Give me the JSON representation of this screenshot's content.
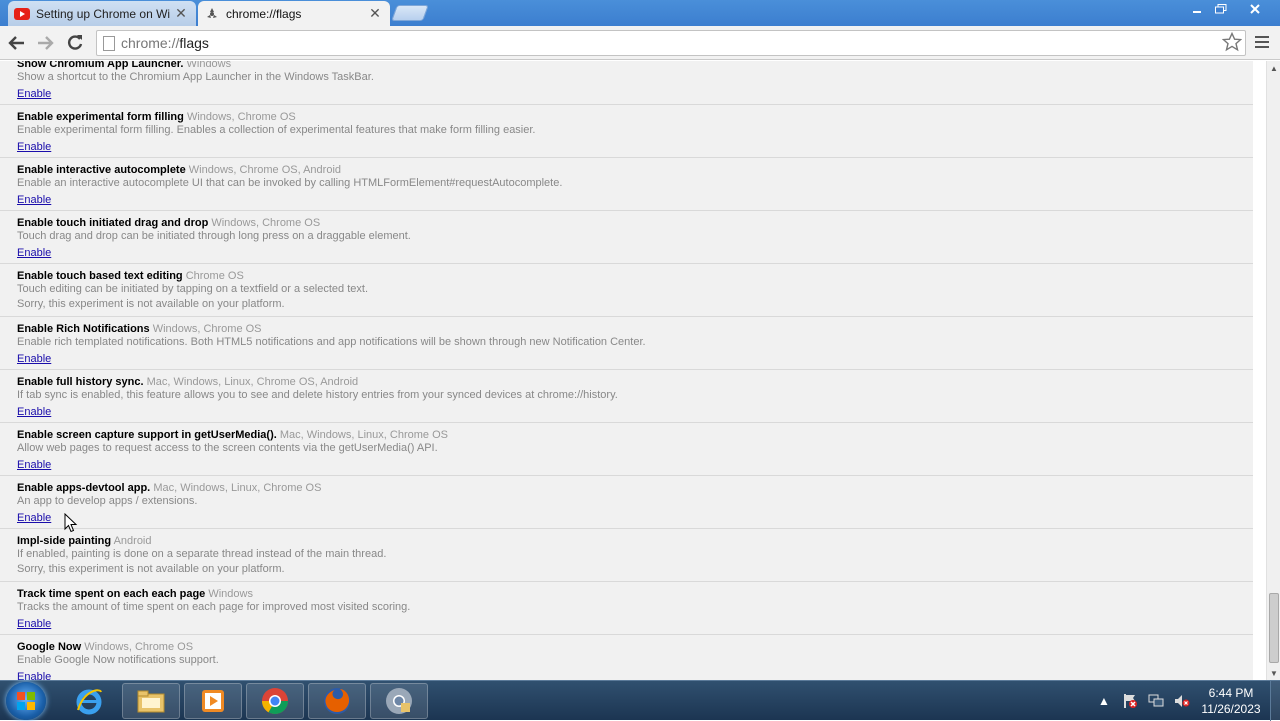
{
  "tabs": [
    {
      "title": "Setting up Chrome on Wi",
      "icon": "youtube-icon",
      "active": false
    },
    {
      "title": "chrome://flags",
      "icon": "flask-icon",
      "active": true
    }
  ],
  "toolbar": {
    "url_scheme": "chrome://",
    "url_host": "flags"
  },
  "experiments_cropped": {
    "name": "Show Chromium App Launcher.",
    "platforms": "Windows",
    "desc": "Show a shortcut to the Chromium App Launcher in the Windows TaskBar.",
    "link": "Enable"
  },
  "experiments": [
    {
      "name": "Enable experimental form filling",
      "platforms": "Windows, Chrome OS",
      "desc": "Enable experimental form filling. Enables a collection of experimental features that make form filling easier.",
      "link": "Enable"
    },
    {
      "name": "Enable interactive autocomplete",
      "platforms": "Windows, Chrome OS, Android",
      "desc": "Enable an interactive autocomplete UI that can be invoked by calling HTMLFormElement#requestAutocomplete.",
      "link": "Enable"
    },
    {
      "name": "Enable touch initiated drag and drop",
      "platforms": "Windows, Chrome OS",
      "desc": "Touch drag and drop can be initiated through long press on a draggable element.",
      "link": "Enable"
    },
    {
      "name": "Enable touch based text editing",
      "platforms": "Chrome OS",
      "desc": "Touch editing can be initiated by tapping on a textfield or a selected text.",
      "unavailable": "Sorry, this experiment is not available on your platform."
    },
    {
      "name": "Enable Rich Notifications",
      "platforms": "Windows, Chrome OS",
      "desc": "Enable rich templated notifications. Both HTML5 notifications and app notifications will be shown through new Notification Center.",
      "link": "Enable"
    },
    {
      "name": "Enable full history sync.",
      "platforms": "Mac, Windows, Linux, Chrome OS, Android",
      "desc": "If tab sync is enabled, this feature allows you to see and delete history entries from your synced devices at chrome://history.",
      "link": "Enable"
    },
    {
      "name": "Enable screen capture support in getUserMedia().",
      "platforms": "Mac, Windows, Linux, Chrome OS",
      "desc": "Allow web pages to request access to the screen contents via the getUserMedia() API.",
      "link": "Enable"
    },
    {
      "name": "Enable apps-devtool app.",
      "platforms": "Mac, Windows, Linux, Chrome OS",
      "desc": "An app to develop apps / extensions.",
      "link": "Enable"
    },
    {
      "name": "Impl-side painting",
      "platforms": "Android",
      "desc": "If enabled, painting is done on a separate thread instead of the main thread.",
      "unavailable": "Sorry, this experiment is not available on your platform."
    },
    {
      "name": "Track time spent on each each page",
      "platforms": "Windows",
      "desc": "Tracks the amount of time spent on each page for improved most visited scoring.",
      "link": "Enable"
    },
    {
      "name": "Google Now",
      "platforms": "Windows, Chrome OS",
      "desc": "Enable Google Now notifications support.",
      "link": "Enable"
    }
  ],
  "taskbar": {
    "items": [
      "internet-explorer-icon",
      "file-explorer-icon",
      "media-player-icon",
      "chrome-icon",
      "firefox-icon",
      "chrome-canary-icon"
    ],
    "clock_time": "6:44 PM",
    "clock_date": "11/26/2023"
  },
  "colors": {
    "link": "#1a0dab",
    "platform_text": "#999999",
    "row_bg": "#f1f1f1",
    "taskbar": "#1c3552"
  }
}
